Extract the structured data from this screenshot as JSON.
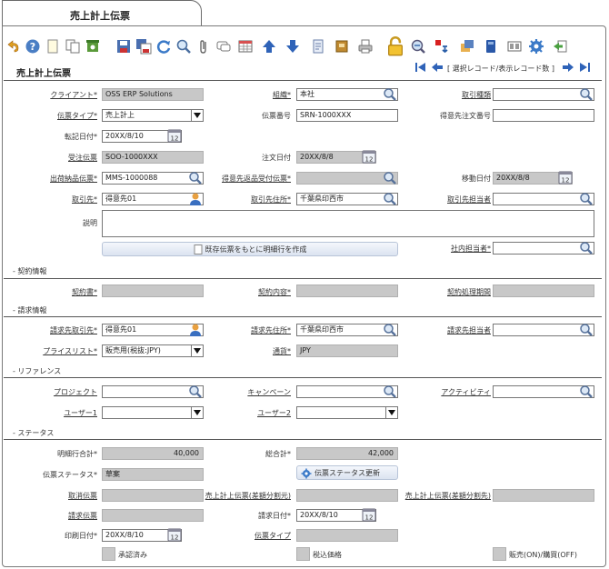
{
  "tab_title": "売上計上伝票",
  "form_title": "売上計上伝票",
  "nav": {
    "record_text": "[ 選択レコード/表示レコード数 ]"
  },
  "toolbar": [
    "back-icon",
    "help-icon",
    "new-icon",
    "copy-icon",
    "delete-icon",
    "save-icon",
    "save-copy-icon",
    "refresh-icon",
    "search-icon",
    "attach-icon",
    "comment-icon",
    "grid-icon",
    "up-icon",
    "down-icon",
    "report-icon",
    "notebook-icon",
    "print-icon",
    "lock-icon",
    "zoom-icon",
    "flag-icon",
    "workflow-icon",
    "archive-icon",
    "cards-icon",
    "settings-icon",
    "exit-icon"
  ],
  "fields": {
    "client": {
      "label": "クライアント*",
      "value": "OSS ERP Solutions"
    },
    "org": {
      "label": "組織*",
      "value": "本社"
    },
    "trade_type": {
      "label": "取引種類",
      "value": ""
    },
    "doc_type": {
      "label": "伝票タイプ*",
      "value": "売上計上"
    },
    "doc_no": {
      "label": "伝票番号",
      "value": "SRN-1000XXX"
    },
    "customer_po": {
      "label": "得意先注文番号",
      "value": ""
    },
    "posting_date": {
      "label": "転記日付*",
      "value": "20XX/8/10"
    },
    "order_doc": {
      "label": "受注伝票",
      "value": "SOO-1000XXX"
    },
    "order_date": {
      "label": "注文日付",
      "value": "20XX/8/8"
    },
    "ship_doc": {
      "label": "出荷納品伝票*",
      "value": "MMS-1000088"
    },
    "return_doc": {
      "label": "得意先返品受付伝票*",
      "value": ""
    },
    "move_date": {
      "label": "移動日付",
      "value": "20XX/8/8"
    },
    "partner": {
      "label": "取引先*",
      "value": "得意先01"
    },
    "partner_addr": {
      "label": "取引先住所*",
      "value": "千葉県印西市"
    },
    "partner_contact": {
      "label": "取引先担当者",
      "value": ""
    },
    "description": {
      "label": "説明",
      "value": ""
    },
    "create_btn": {
      "label": "既存伝票をもとに明細行を作成"
    },
    "sales_rep": {
      "label": "社内担当者*",
      "value": ""
    },
    "contract_section": "- 契約情報",
    "contract": {
      "label": "契約書*",
      "value": ""
    },
    "contract_content": {
      "label": "契約内容*",
      "value": ""
    },
    "contract_period": {
      "label": "契約処理期間",
      "value": ""
    },
    "billing_section": "- 請求情報",
    "bill_partner": {
      "label": "請求先取引先*",
      "value": "得意先01"
    },
    "bill_addr": {
      "label": "請求先住所*",
      "value": "千葉県印西市"
    },
    "bill_contact": {
      "label": "請求先担当者",
      "value": ""
    },
    "pricelist": {
      "label": "プライスリスト*",
      "value": "販売用(税抜:JPY)"
    },
    "currency": {
      "label": "通貨*",
      "value": "JPY"
    },
    "reference_section": "- リファレンス",
    "project": {
      "label": "プロジェクト",
      "value": ""
    },
    "campaign": {
      "label": "キャンペーン",
      "value": ""
    },
    "activity": {
      "label": "アクティビティ",
      "value": ""
    },
    "user1": {
      "label": "ユーザー1",
      "value": ""
    },
    "user2": {
      "label": "ユーザー2",
      "value": ""
    },
    "status_section": "- ステータス",
    "line_total": {
      "label": "明細行合計*",
      "value": "40,000"
    },
    "grand_total": {
      "label": "総合計*",
      "value": "42,000"
    },
    "doc_status": {
      "label": "伝票ステータス*",
      "value": "草案"
    },
    "status_btn": {
      "label": "伝票ステータス更新"
    },
    "cancel_doc": {
      "label": "取消伝票",
      "value": ""
    },
    "sales_diff_1": {
      "label": "売上計上伝票(差額分割元)",
      "value": ""
    },
    "sales_diff_2": {
      "label": "売上計上伝票(差額分割先)",
      "value": ""
    },
    "invoice_doc": {
      "label": "請求伝票",
      "value": ""
    },
    "invoice_date": {
      "label": "請求日付*",
      "value": "20XX/8/10"
    },
    "print_date": {
      "label": "印刷日付*",
      "value": "20XX/8/10"
    },
    "doc_type2": {
      "label": "伝票タイプ",
      "value": ""
    },
    "approved": {
      "label": "承認済み"
    },
    "tax_included": {
      "label": "税込価格"
    },
    "sales_onoff": {
      "label": "販売(ON)/購買(OFF)"
    }
  }
}
